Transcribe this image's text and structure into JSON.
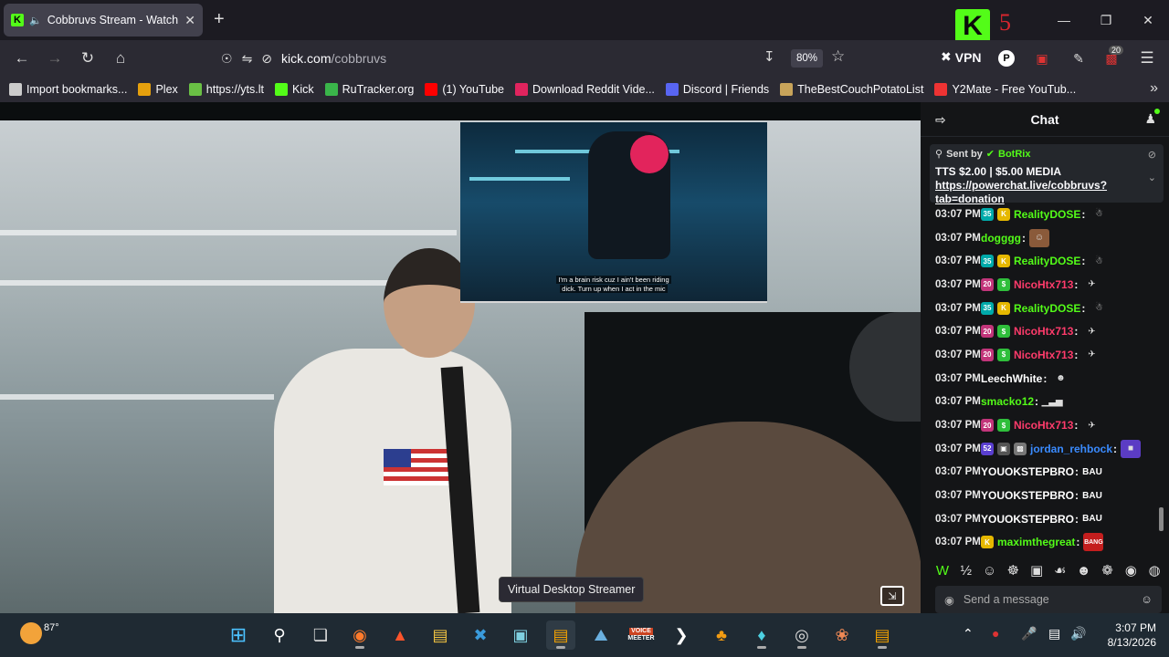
{
  "browser": {
    "tab_title": "Cobbruvs Stream - Watch Li",
    "tab_favicon": "K",
    "new_tab": "+",
    "url_host": "kick.com",
    "url_path": "/cobbruvs",
    "zoom": "80%",
    "vpn_label": "VPN",
    "extension_badge": "20",
    "overlay_k": "K",
    "overlay_number": "5"
  },
  "bookmarks": [
    {
      "label": "Import bookmarks...",
      "icon": "import-icon",
      "color": "#cccccc"
    },
    {
      "label": "Plex",
      "icon": "plex-icon",
      "color": "#e5a00d"
    },
    {
      "label": "https://yts.lt",
      "icon": "yts-icon",
      "color": "#6ac045"
    },
    {
      "label": "Kick",
      "icon": "kick-icon",
      "color": "#53fc18"
    },
    {
      "label": "RuTracker.org",
      "icon": "rutracker-icon",
      "color": "#3ab54a"
    },
    {
      "label": "(1) YouTube",
      "icon": "youtube-icon",
      "color": "#ff0000"
    },
    {
      "label": "Download Reddit Vide...",
      "icon": "reddit-icon",
      "color": "#e0245e"
    },
    {
      "label": "Discord | Friends",
      "icon": "discord-icon",
      "color": "#5865f2"
    },
    {
      "label": "TheBestCouchPotatoList",
      "icon": "couch-icon",
      "color": "#c8a45a"
    },
    {
      "label": "Y2Mate - Free YouTub...",
      "icon": "y2mate-icon",
      "color": "#e33"
    }
  ],
  "video": {
    "pip_caption_line1": "I'm a brain risk cuz I ain't been riding",
    "pip_caption_line2": "dick. Turn up when I act in the mic",
    "tooltip": "Virtual Desktop Streamer"
  },
  "chat": {
    "title": "Chat",
    "pinned": {
      "sent_by_label": "Sent by",
      "sender": "BotRix",
      "text": "TTS $2.00 | $5.00 MEDIA ",
      "link": "https://powerchat.live/cobbruvs?tab=donation"
    },
    "messages": [
      {
        "time": "03:07 PM",
        "user": "RealityDOSE",
        "color": "#53fc18",
        "badges": [
          {
            "t": "35",
            "c": "#0aa"
          },
          {
            "t": "K",
            "c": "#e6b800"
          }
        ],
        "emote": "☃",
        "emote_bg": "transparent"
      },
      {
        "time": "03:07 PM",
        "user": "dogggg",
        "color": "#53fc18",
        "badges": [],
        "emote": "☺",
        "emote_bg": "#8a5a3a"
      },
      {
        "time": "03:07 PM",
        "user": "RealityDOSE",
        "color": "#53fc18",
        "badges": [
          {
            "t": "35",
            "c": "#0aa"
          },
          {
            "t": "K",
            "c": "#e6b800"
          }
        ],
        "emote": "☃",
        "emote_bg": "transparent"
      },
      {
        "time": "03:07 PM",
        "user": "NicoHtx713",
        "color": "#ff3b6b",
        "badges": [
          {
            "t": "20",
            "c": "#c2357a"
          },
          {
            "t": "$",
            "c": "#2fbf3b"
          }
        ],
        "emote": "✈",
        "emote_bg": "transparent"
      },
      {
        "time": "03:07 PM",
        "user": "RealityDOSE",
        "color": "#53fc18",
        "badges": [
          {
            "t": "35",
            "c": "#0aa"
          },
          {
            "t": "K",
            "c": "#e6b800"
          }
        ],
        "emote": "☃",
        "emote_bg": "transparent"
      },
      {
        "time": "03:07 PM",
        "user": "NicoHtx713",
        "color": "#ff3b6b",
        "badges": [
          {
            "t": "20",
            "c": "#c2357a"
          },
          {
            "t": "$",
            "c": "#2fbf3b"
          }
        ],
        "emote": "✈",
        "emote_bg": "transparent"
      },
      {
        "time": "03:07 PM",
        "user": "NicoHtx713",
        "color": "#ff3b6b",
        "badges": [
          {
            "t": "20",
            "c": "#c2357a"
          },
          {
            "t": "$",
            "c": "#2fbf3b"
          }
        ],
        "emote": "✈",
        "emote_bg": "transparent"
      },
      {
        "time": "03:07 PM",
        "user": "LeechWhite",
        "color": "#ffffff",
        "badges": [],
        "emote": "☻",
        "emote_bg": "transparent"
      },
      {
        "time": "03:07 PM",
        "user": "smacko12",
        "color": "#53fc18",
        "badges": [],
        "emote": "▁▃▅",
        "emote_bg": "transparent"
      },
      {
        "time": "03:07 PM",
        "user": "NicoHtx713",
        "color": "#ff3b6b",
        "badges": [
          {
            "t": "20",
            "c": "#c2357a"
          },
          {
            "t": "$",
            "c": "#2fbf3b"
          }
        ],
        "emote": "✈",
        "emote_bg": "transparent"
      },
      {
        "time": "03:07 PM",
        "user": "jordan_rehbock",
        "color": "#3a8bff",
        "badges": [
          {
            "t": "52",
            "c": "#5a3fd0"
          },
          {
            "t": "▣",
            "c": "#555"
          },
          {
            "t": "▩",
            "c": "#777"
          }
        ],
        "emote": "■",
        "emote_bg": "#5b3cc4"
      },
      {
        "time": "03:07 PM",
        "user": "YOUOKSTEPBRO",
        "color": "#ffffff",
        "badges": [],
        "emote": "BAU",
        "emote_bg": "transparent"
      },
      {
        "time": "03:07 PM",
        "user": "YOUOKSTEPBRO",
        "color": "#ffffff",
        "badges": [],
        "emote": "BAU",
        "emote_bg": "transparent"
      },
      {
        "time": "03:07 PM",
        "user": "YOUOKSTEPBRO",
        "color": "#ffffff",
        "badges": [],
        "emote": "BAU",
        "emote_bg": "transparent"
      },
      {
        "time": "03:07 PM",
        "user": "maximthegreat",
        "color": "#53fc18",
        "badges": [
          {
            "t": "K",
            "c": "#e6b800"
          }
        ],
        "emote": "BANG",
        "emote_bg": "#c41e1e"
      }
    ],
    "emote_bar": [
      "W",
      "½",
      "☺",
      "☸",
      "▣",
      "☙",
      "☻",
      "❁",
      "◉",
      "◍"
    ],
    "input_placeholder": "Send a message"
  },
  "taskbar": {
    "temperature": "87°",
    "time": "3:07 PM",
    "date": "8/13/2026",
    "voicemeeter_label_top": "VOICE",
    "voicemeeter_label_bottom": "MEETER"
  }
}
